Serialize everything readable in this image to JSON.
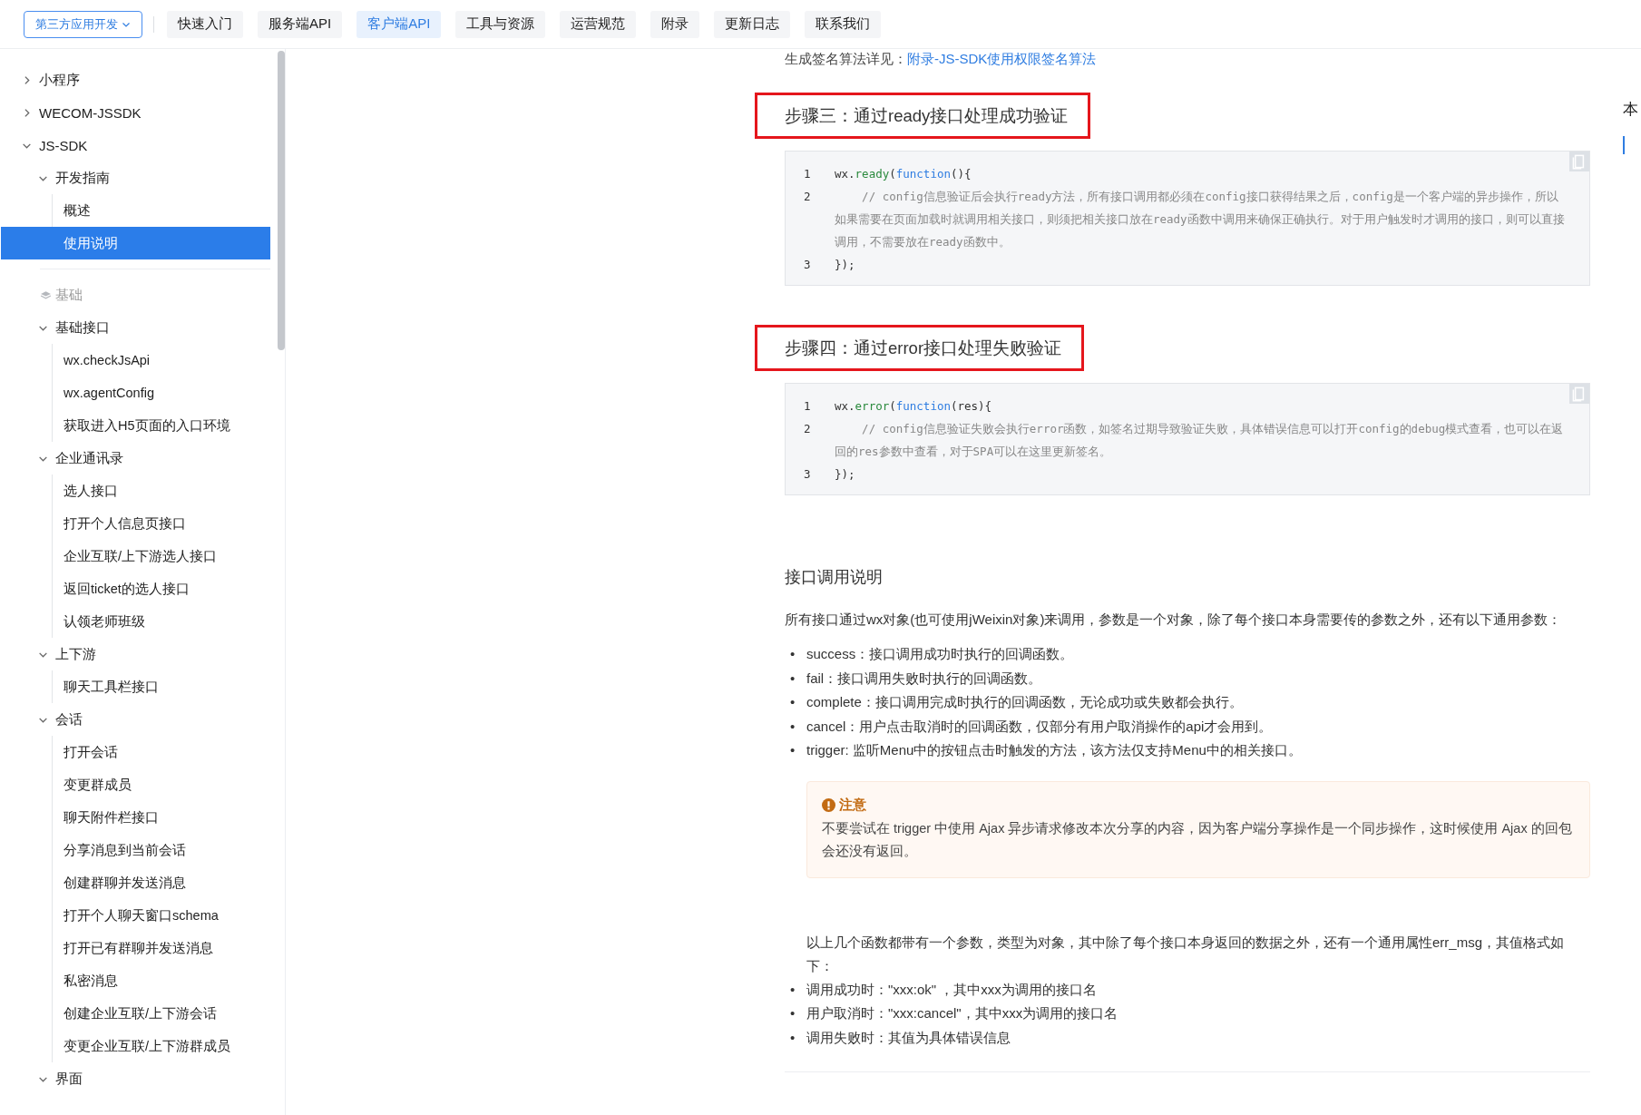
{
  "nav": {
    "dropdown": "第三方应用开发",
    "tabs": [
      {
        "label": "快速入门",
        "selected": false
      },
      {
        "label": "服务端API",
        "selected": false
      },
      {
        "label": "客户端API",
        "selected": true
      },
      {
        "label": "工具与资源",
        "selected": false
      },
      {
        "label": "运营规范",
        "selected": false
      },
      {
        "label": "附录",
        "selected": false
      },
      {
        "label": "更新日志",
        "selected": false
      },
      {
        "label": "联系我们",
        "selected": false
      }
    ]
  },
  "sidebar": {
    "items": [
      {
        "kind": "node",
        "label": "小程序",
        "expanded": false
      },
      {
        "kind": "node",
        "label": "WECOM-JSSDK",
        "expanded": false
      },
      {
        "kind": "node",
        "label": "JS-SDK",
        "expanded": true,
        "children": [
          {
            "kind": "node",
            "label": "开发指南",
            "expanded": true,
            "children": [
              {
                "kind": "leaf",
                "label": "概述",
                "selected": false
              },
              {
                "kind": "leaf",
                "label": "使用说明",
                "selected": true
              }
            ]
          },
          {
            "kind": "divider"
          },
          {
            "kind": "group",
            "label": "基础"
          },
          {
            "kind": "node",
            "label": "基础接口",
            "expanded": true,
            "children": [
              {
                "kind": "leaf",
                "label": "wx.checkJsApi",
                "selected": false
              },
              {
                "kind": "leaf",
                "label": "wx.agentConfig",
                "selected": false
              },
              {
                "kind": "leaf",
                "label": "获取进入H5页面的入口环境",
                "selected": false
              }
            ]
          },
          {
            "kind": "node",
            "label": "企业通讯录",
            "expanded": true,
            "children": [
              {
                "kind": "leaf",
                "label": "选人接口",
                "selected": false
              },
              {
                "kind": "leaf",
                "label": "打开个人信息页接口",
                "selected": false
              },
              {
                "kind": "leaf",
                "label": "企业互联/上下游选人接口",
                "selected": false
              },
              {
                "kind": "leaf",
                "label": "返回ticket的选人接口",
                "selected": false
              },
              {
                "kind": "leaf",
                "label": "认领老师班级",
                "selected": false
              }
            ]
          },
          {
            "kind": "node",
            "label": "上下游",
            "expanded": true,
            "children": [
              {
                "kind": "leaf",
                "label": "聊天工具栏接口",
                "selected": false
              }
            ]
          },
          {
            "kind": "node",
            "label": "会话",
            "expanded": true,
            "children": [
              {
                "kind": "leaf",
                "label": "打开会话",
                "selected": false
              },
              {
                "kind": "leaf",
                "label": "变更群成员",
                "selected": false
              },
              {
                "kind": "leaf",
                "label": "聊天附件栏接口",
                "selected": false
              },
              {
                "kind": "leaf",
                "label": "分享消息到当前会话",
                "selected": false
              },
              {
                "kind": "leaf",
                "label": "创建群聊并发送消息",
                "selected": false
              },
              {
                "kind": "leaf",
                "label": "打开个人聊天窗口schema",
                "selected": false
              },
              {
                "kind": "leaf",
                "label": "打开已有群聊并发送消息",
                "selected": false
              },
              {
                "kind": "leaf",
                "label": "私密消息",
                "selected": false
              },
              {
                "kind": "leaf",
                "label": "创建企业互联/上下游会话",
                "selected": false
              },
              {
                "kind": "leaf",
                "label": "变更企业互联/上下游群成员",
                "selected": false
              }
            ]
          },
          {
            "kind": "node",
            "label": "界面",
            "expanded": true
          }
        ]
      }
    ]
  },
  "content": [
    {
      "kind": "link_line",
      "text": "生成签名算法详见：",
      "link": "附录-JS-SDK使用权限签名算法"
    },
    {
      "kind": "heading",
      "text": "步骤三：通过ready接口处理成功验证",
      "highlighted": true
    },
    {
      "kind": "code",
      "lines": [
        {
          "number": "1",
          "segments": [
            {
              "kind": "plain",
              "text": "wx."
            },
            {
              "kind": "fn",
              "text": "ready"
            },
            {
              "kind": "plain",
              "text": "("
            },
            {
              "kind": "kw",
              "text": "function"
            },
            {
              "kind": "plain",
              "text": "(){"
            }
          ]
        },
        {
          "number": "2",
          "segments": [
            {
              "kind": "comment",
              "text": "    // config信息验证后会执行ready方法，所有接口调用都必须在config接口获得结果之后，config是一个客户端的异步操作，所以如果需要在页面加载时就调用相关接口，则须把相关接口放在ready函数中调用来确保正确执行。对于用户触发时才调用的接口，则可以直接调用，不需要放在ready函数中。"
            }
          ]
        },
        {
          "number": "3",
          "segments": [
            {
              "kind": "plain",
              "text": "});"
            }
          ]
        }
      ]
    },
    {
      "kind": "heading",
      "text": "步骤四：通过error接口处理失败验证",
      "highlighted": true
    },
    {
      "kind": "code",
      "lines": [
        {
          "number": "1",
          "segments": [
            {
              "kind": "plain",
              "text": "wx."
            },
            {
              "kind": "fn",
              "text": "error"
            },
            {
              "kind": "plain",
              "text": "("
            },
            {
              "kind": "kw",
              "text": "function"
            },
            {
              "kind": "plain",
              "text": "(res){"
            }
          ]
        },
        {
          "number": "2",
          "segments": [
            {
              "kind": "comment",
              "text": "    // config信息验证失败会执行error函数，如签名过期导致验证失败，具体错误信息可以打开config的debug模式查看，也可以在返回的res参数中查看，对于SPA可以在这里更新签名。"
            }
          ]
        },
        {
          "number": "3",
          "segments": [
            {
              "kind": "plain",
              "text": "});"
            }
          ]
        }
      ]
    },
    {
      "kind": "subheading",
      "text": "接口调用说明"
    },
    {
      "kind": "paragraph",
      "text": "所有接口通过wx对象(也可使用jWeixin对象)来调用，参数是一个对象，除了每个接口本身需要传的参数之外，还有以下通用参数："
    },
    {
      "kind": "list",
      "bullet": "•",
      "items": [
        "success：接口调用成功时执行的回调函数。",
        "fail：接口调用失败时执行的回调函数。",
        "complete：接口调用完成时执行的回调函数，无论成功或失败都会执行。",
        "cancel：用户点击取消时的回调函数，仅部分有用户取消操作的api才会用到。",
        "trigger: 监听Menu中的按钮点击时触发的方法，该方法仅支持Menu中的相关接口。"
      ]
    },
    {
      "kind": "notice",
      "title": "注意",
      "text": "不要尝试在 trigger 中使用 Ajax 异步请求修改本次分享的内容，因为客户端分享操作是一个同步操作，这时候使用 Ajax 的回包会还没有返回。"
    },
    {
      "kind": "indented_paragraph",
      "text": "以上几个函数都带有一个参数，类型为对象，其中除了每个接口本身返回的数据之外，还有一个通用属性err_msg，其值格式如下："
    },
    {
      "kind": "list",
      "bullet": "•",
      "items": [
        "调用成功时：\"xxx:ok\" ，其中xxx为调用的接口名",
        "用户取消时：\"xxx:cancel\"，其中xxx为调用的接口名",
        "调用失败时：其值为具体错误信息"
      ]
    }
  ],
  "toc": {
    "title": "本"
  }
}
